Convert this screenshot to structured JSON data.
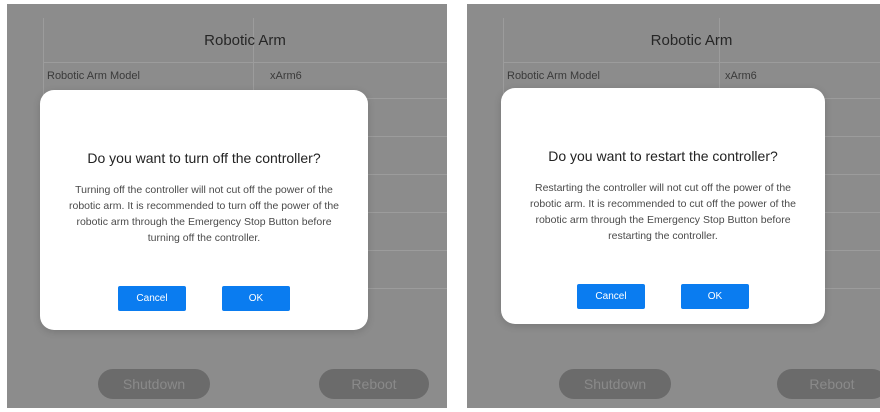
{
  "left_panel": {
    "title": "Robotic Arm",
    "row_label": "Robotic Arm Model",
    "row_value": "xArm6",
    "dialog": {
      "question": "Do you want to turn off the controller?",
      "message": "Turning off the controller will not cut off the power of the robotic arm. It is recommended to turn off the power of the robotic arm through the Emergency Stop Button before turning off the controller.",
      "cancel_label": "Cancel",
      "ok_label": "OK"
    },
    "shutdown_label": "Shutdown",
    "reboot_label": "Reboot"
  },
  "right_panel": {
    "title": "Robotic Arm",
    "row_label": "Robotic Arm Model",
    "row_value": "xArm6",
    "dialog": {
      "question": "Do you want to restart the controller?",
      "message": "Restarting the controller will not cut off the power of the robotic arm. It is recommended to cut off the power of the robotic arm through the Emergency Stop Button before restarting the controller.",
      "cancel_label": "Cancel",
      "ok_label": "OK"
    },
    "shutdown_label": "Shutdown",
    "reboot_label": "Reboot"
  },
  "colors": {
    "overlay": "#8c8c8c",
    "primary_button": "#0a7cf0",
    "disabled_button": "#6b6b6b"
  }
}
